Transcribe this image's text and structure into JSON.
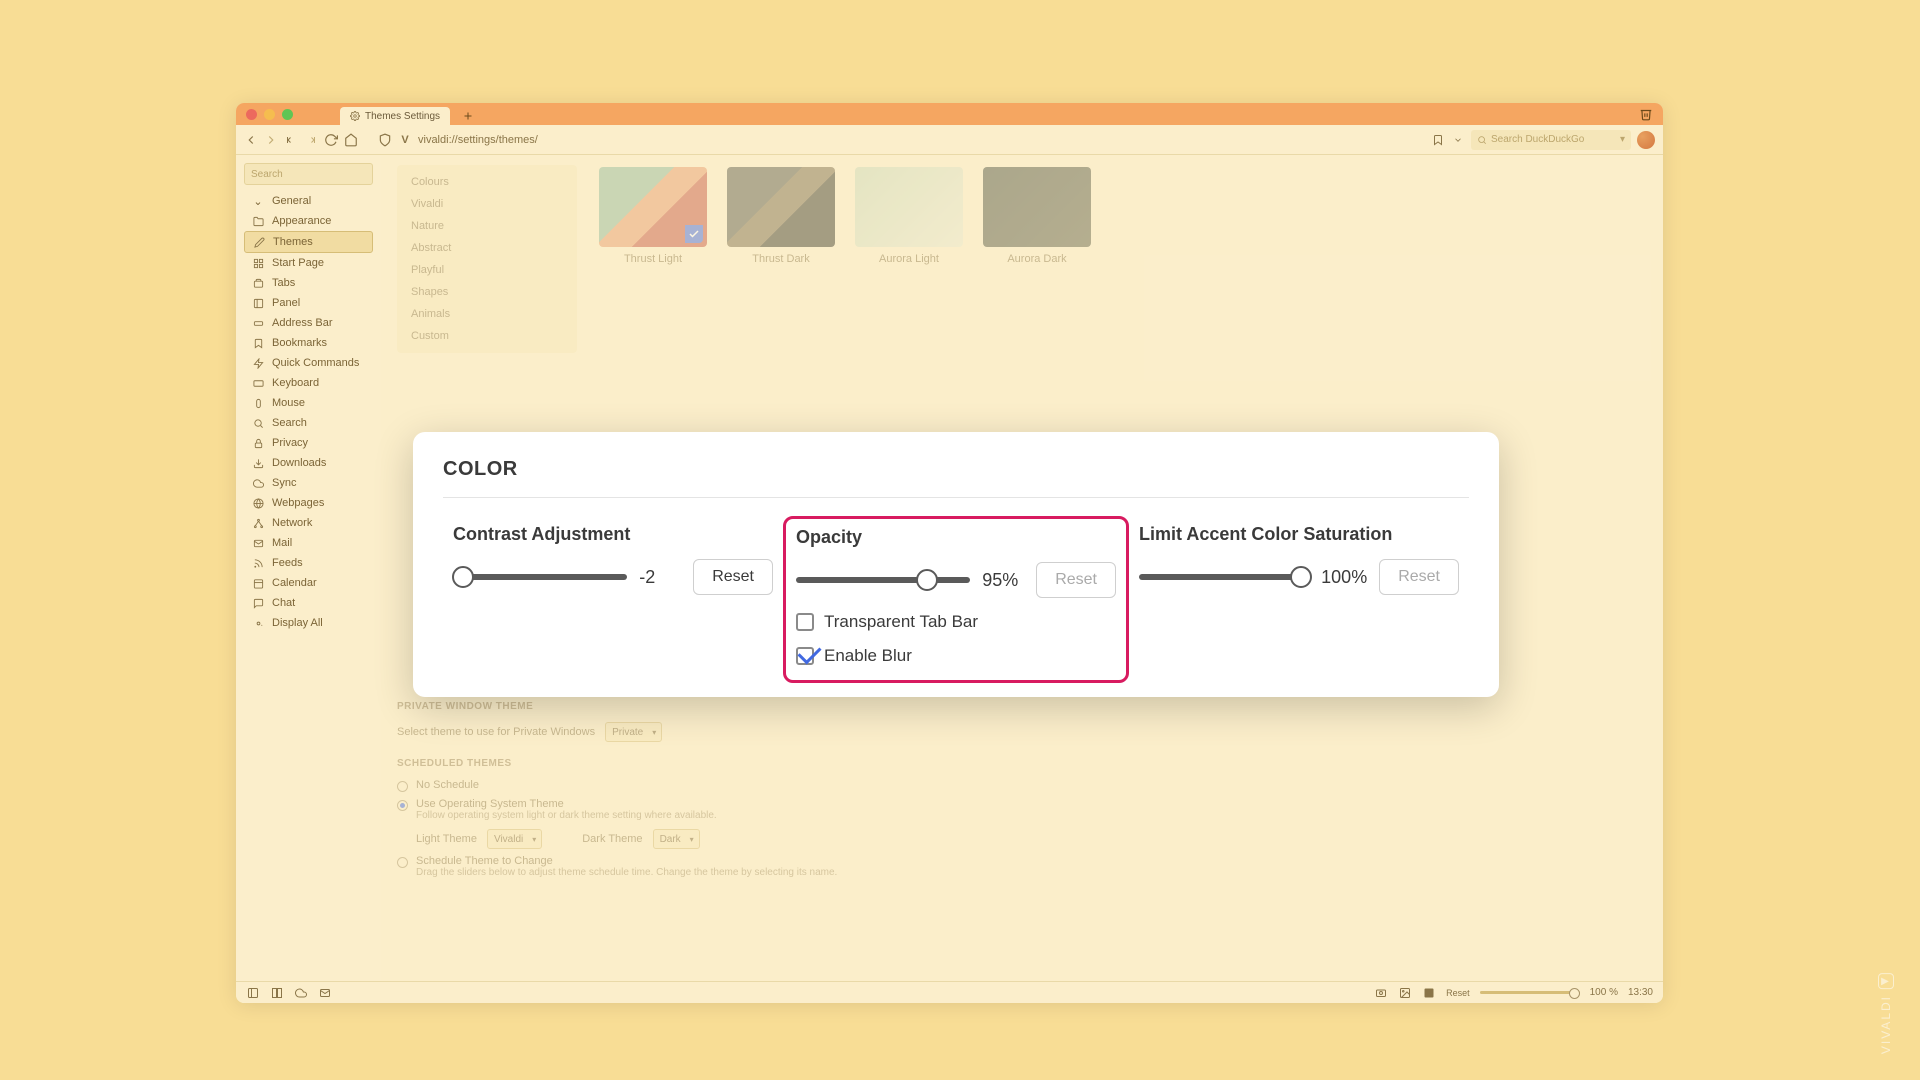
{
  "tab": {
    "title": "Themes Settings"
  },
  "addr": {
    "url": "vivaldi://settings/themes/",
    "search_placeholder": "Search DuckDuckGo"
  },
  "sidebar": {
    "search_placeholder": "Search",
    "items": [
      {
        "label": "General"
      },
      {
        "label": "Appearance"
      },
      {
        "label": "Themes"
      },
      {
        "label": "Start Page"
      },
      {
        "label": "Tabs"
      },
      {
        "label": "Panel"
      },
      {
        "label": "Address Bar"
      },
      {
        "label": "Bookmarks"
      },
      {
        "label": "Quick Commands"
      },
      {
        "label": "Keyboard"
      },
      {
        "label": "Mouse"
      },
      {
        "label": "Search"
      },
      {
        "label": "Privacy"
      },
      {
        "label": "Downloads"
      },
      {
        "label": "Sync"
      },
      {
        "label": "Webpages"
      },
      {
        "label": "Network"
      },
      {
        "label": "Mail"
      },
      {
        "label": "Feeds"
      },
      {
        "label": "Calendar"
      },
      {
        "label": "Chat"
      },
      {
        "label": "Display All"
      }
    ]
  },
  "categories": [
    "Colours",
    "Vivaldi",
    "Nature",
    "Abstract",
    "Playful",
    "Shapes",
    "Animals",
    "Custom"
  ],
  "themes": [
    {
      "name": "Thrust Light"
    },
    {
      "name": "Thrust Dark"
    },
    {
      "name": "Aurora Light"
    },
    {
      "name": "Aurora Dark"
    }
  ],
  "color_panel": {
    "title": "COLOR",
    "contrast": {
      "label": "Contrast Adjustment",
      "value": "-2",
      "reset": "Reset",
      "handle_pct": 6
    },
    "opacity": {
      "label": "Opacity",
      "value": "95%",
      "reset": "Reset",
      "handle_pct": 75,
      "chk1": "Transparent Tab Bar",
      "chk2": "Enable Blur"
    },
    "satur": {
      "label": "Limit Accent Color Saturation",
      "value": "100%",
      "reset": "Reset",
      "handle_pct": 95
    }
  },
  "lower": {
    "private_h": "PRIVATE WINDOW THEME",
    "private_txt": "Select theme to use for Private Windows",
    "private_sel": "Private",
    "sched_h": "SCHEDULED THEMES",
    "r1": "No Schedule",
    "r2": "Use Operating System Theme",
    "r2_help": "Follow operating system light or dark theme setting where available.",
    "light_lbl": "Light Theme",
    "light_sel": "Vivaldi",
    "dark_lbl": "Dark Theme",
    "dark_sel": "Dark",
    "r3": "Schedule Theme to Change",
    "r3_help": "Drag the sliders below to adjust theme schedule time. Change the theme by selecting its name."
  },
  "status": {
    "reset": "Reset",
    "zoom": "100 %",
    "time": "13:30"
  },
  "watermark": "VIVALDI"
}
